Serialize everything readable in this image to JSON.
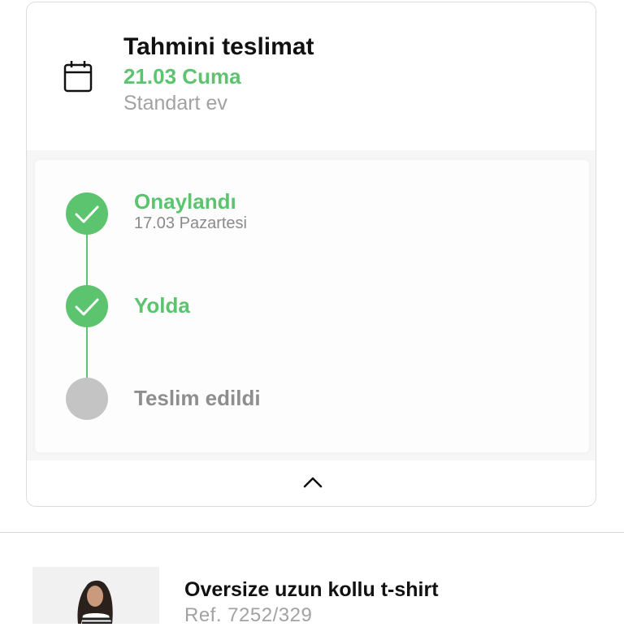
{
  "delivery": {
    "title": "Tahmini teslimat",
    "date": "21.03 Cuma",
    "type": "Standart ev",
    "icon": "calendar-icon"
  },
  "timeline": {
    "steps": [
      {
        "label": "Onaylandı",
        "sub": "17.03 Pazartesi",
        "status": "done"
      },
      {
        "label": "Yolda",
        "sub": "",
        "status": "done"
      },
      {
        "label": "Teslim edildi",
        "sub": "",
        "status": "pending"
      }
    ],
    "collapse_icon": "chevron-up-icon"
  },
  "product": {
    "name": "Oversize uzun kollu t-shirt",
    "ref": "Ref.  7252/329"
  },
  "colors": {
    "accent_green": "#5cc46e",
    "pending_gray": "#c4c4c4",
    "muted_text": "#a2a2a2"
  }
}
